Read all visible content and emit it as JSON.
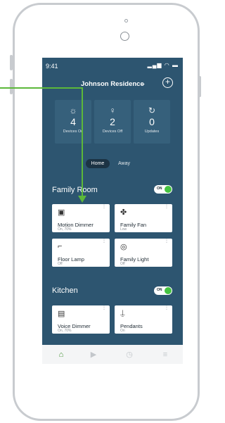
{
  "status": {
    "time": "9:41",
    "icons": "▂▄▆ ◠ ▬"
  },
  "header": {
    "title": "Johnson Residence",
    "chevron": "⌄",
    "add_label": "+"
  },
  "stats": [
    {
      "icon": "bulb-on-icon",
      "glyph": "☼",
      "value": "4",
      "label": "Devices On"
    },
    {
      "icon": "bulb-off-icon",
      "glyph": "♀",
      "value": "2",
      "label": "Devices Off"
    },
    {
      "icon": "refresh-icon",
      "glyph": "↻",
      "value": "0",
      "label": "Updates"
    }
  ],
  "mode": {
    "home": "Home",
    "away": "Away"
  },
  "rooms": [
    {
      "name": "Family Room",
      "toggle": "ON",
      "devices": [
        {
          "icon": "dimmer-switch-icon",
          "glyph": "▣",
          "name": "Motion Dimmer",
          "status": "On, 70%"
        },
        {
          "icon": "ceiling-fan-icon",
          "glyph": "✤",
          "name": "Family Fan",
          "status": "Low"
        },
        {
          "icon": "floor-lamp-icon",
          "glyph": "⌐",
          "name": "Floor Lamp",
          "status": "Off"
        },
        {
          "icon": "ceiling-light-icon",
          "glyph": "◎",
          "name": "Family Light",
          "status": "Off"
        }
      ]
    },
    {
      "name": "Kitchen",
      "toggle": "ON",
      "devices": [
        {
          "icon": "voice-dimmer-icon",
          "glyph": "▤",
          "name": "Voice Dimmer",
          "status": "On, 70%"
        },
        {
          "icon": "pendant-light-icon",
          "glyph": "⍊",
          "name": "Pendants",
          "status": "On"
        }
      ]
    }
  ],
  "tabbar": [
    {
      "name": "tab-home",
      "icon": "home-icon",
      "glyph": "⌂"
    },
    {
      "name": "tab-scenes",
      "icon": "play-icon",
      "glyph": "▶"
    },
    {
      "name": "tab-schedule",
      "icon": "clock-icon",
      "glyph": "◷"
    },
    {
      "name": "tab-menu",
      "icon": "menu-icon",
      "glyph": "≡"
    }
  ],
  "colors": {
    "screen_bg": "#2d5570",
    "tile_bg": "#36607b",
    "accent_green": "#45c341",
    "annotation_arrow": "#5cb83a",
    "tab_active": "#3e8f2e"
  }
}
